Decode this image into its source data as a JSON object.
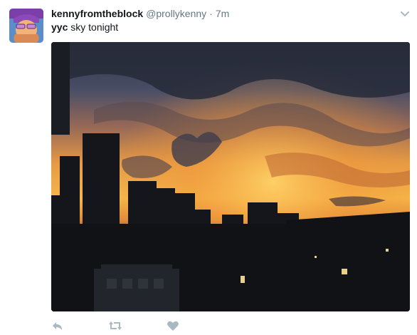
{
  "tweet": {
    "display_name": "kennyfromtheblock",
    "handle": "@prollykenny",
    "separator": "·",
    "timestamp": "7m",
    "text_bold": "yyc",
    "text_rest": " sky tonight"
  },
  "icons": {
    "caret": "chevron-down-icon",
    "reply": "reply-icon",
    "retweet": "retweet-icon",
    "like": "heart-icon"
  },
  "colors": {
    "text": "#14171a",
    "secondary": "#657786",
    "action": "#aab8c2"
  }
}
